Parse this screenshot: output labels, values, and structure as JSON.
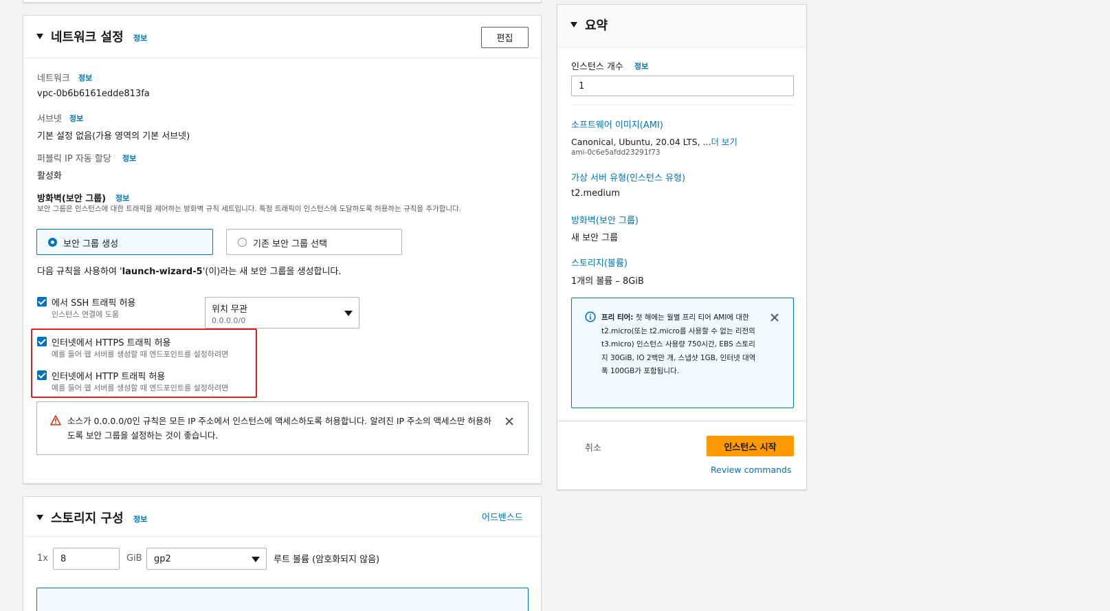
{
  "network": {
    "title": "네트워크 설정",
    "info": "정보",
    "edit_button": "편집",
    "network_label": "네트워크",
    "network_value": "vpc-0b6b6161edde813fa",
    "subnet_label": "서브넷",
    "subnet_value": "기본 설정 없음(가용 영역의 기본 서브넷)",
    "public_ip_label": "퍼블릭 IP 자동 할당",
    "public_ip_value": "활성화",
    "firewall_label": "방화벽(보안 그룹)",
    "firewall_desc": "보안 그룹은 인스턴스에 대한 트래픽을 제어하는 방화벽 규칙 세트입니다. 특정 트래픽이 인스턴스에 도달하도록 허용하는 규칙을 추가합니다.",
    "option_create": "보안 그룹 생성",
    "option_existing": "기존 보안 그룹 선택",
    "rule_prefix": "다음 규칙을 사용하여 '",
    "rule_name": "launch-wizard-5",
    "rule_suffix": "'(이)라는 새 보안 그룹을 생성합니다.",
    "ssh_title": "에서 SSH 트래픽 허용",
    "ssh_desc": "인스턴스 연결에 도움",
    "ssh_select_value": "위치 무관",
    "ssh_select_sub": "0.0.0.0/0",
    "https_title": "인터넷에서 HTTPS 트래픽 허용",
    "https_desc": "예를 들어 웹 서버를 생성할 때 엔드포인트를 설정하려면",
    "http_title": "인터넷에서 HTTP 트래픽 허용",
    "http_desc": "예를 들어 웹 서버를 생성할 때 엔드포인트를 설정하려면",
    "warning_text": "소스가 0.0.0.0/0인 규칙은 모든 IP 주소에서 인스턴스에 액세스하도록 허용합니다. 알려진 IP 주소의 액세스만 허용하도록 보안 그룹을 설정하는 것이 좋습니다."
  },
  "storage": {
    "title": "스토리지 구성",
    "info": "정보",
    "advanced_link": "어드밴스드",
    "count_label": "1x",
    "size_value": "8",
    "unit_label": "GiB",
    "type_value": "gp2",
    "root_label": "루트 볼륨 (암호화되지 않음)"
  },
  "summary": {
    "title": "요약",
    "instance_count_label": "인스턴스 개수",
    "info": "정보",
    "instance_count_value": "1",
    "ami_link": "소프트웨어 이미지(AMI)",
    "ami_value": "Canonical, Ubuntu, 20.04 LTS, ...",
    "ami_more": "더 보기",
    "ami_id": "ami-0c6e5afdd23291f73",
    "type_link": "가상 서버 유형(인스턴스 유형)",
    "type_value": "t2.medium",
    "firewall_link": "방화벽(보안 그룹)",
    "firewall_value": "새 보안 그룹",
    "storage_link": "스토리지(볼륨)",
    "storage_value": "1개의 볼륨 – 8GiB",
    "free_tier_bold": "프리 티어:",
    "free_tier_text": " 첫 해에는 월별 프리 티어 AMI에 대한 t2.micro(또는 t2.micro를 사용할 수 없는 리전의 t3.micro) 인스턴스 사용량 750시간, EBS 스토리지 30GiB, IO 2백만 개, 스냅샷 1GB, 인터넷 대역폭 100GB가 포함됩니다.",
    "cancel_button": "취소",
    "launch_button": "인스턴스 시작",
    "review_link": "Review commands"
  },
  "colors": {
    "accent": "#0073bb",
    "launch": "#ff9900",
    "highlight": "#e02020",
    "warning": "#d13212"
  }
}
